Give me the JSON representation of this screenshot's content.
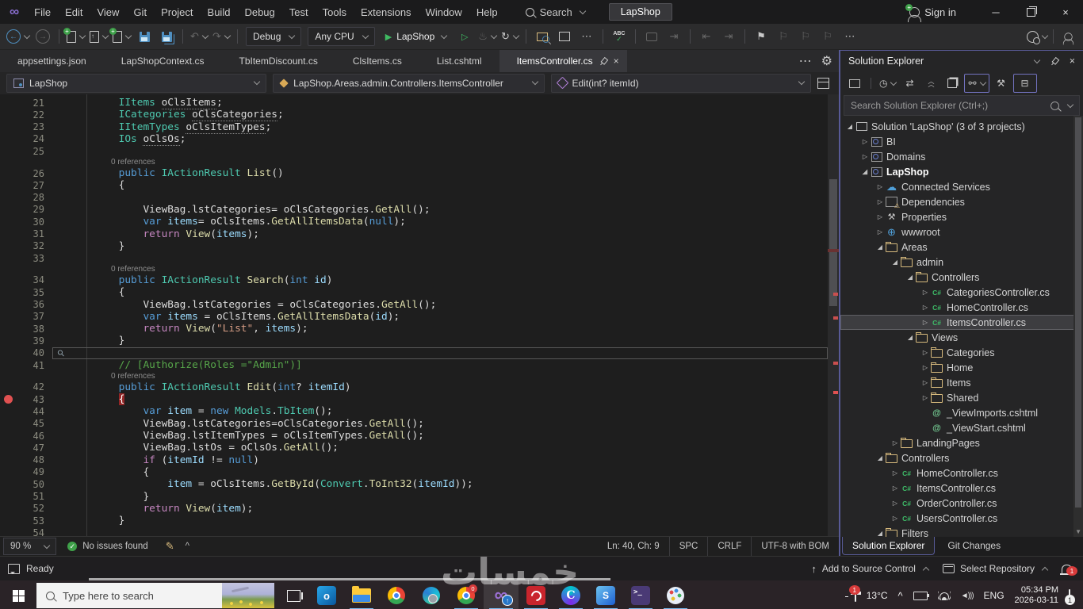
{
  "titlebar": {
    "menus": [
      "File",
      "Edit",
      "View",
      "Git",
      "Project",
      "Build",
      "Debug",
      "Test",
      "Tools",
      "Extensions",
      "Window",
      "Help"
    ],
    "search_label": "Search",
    "app_button": "LapShop",
    "sign_in": "Sign in"
  },
  "toolbar": {
    "config": "Debug",
    "platform": "Any CPU",
    "run_target": "LapShop"
  },
  "tabs": {
    "items": [
      {
        "label": "appsettings.json",
        "active": false
      },
      {
        "label": "LapShopContext.cs",
        "active": false
      },
      {
        "label": "TbItemDiscount.cs",
        "active": false
      },
      {
        "label": "ClsItems.cs",
        "active": false
      },
      {
        "label": "List.cshtml",
        "active": false
      },
      {
        "label": "ItemsController.cs",
        "active": true
      }
    ]
  },
  "breadcrumb": {
    "project": "LapShop",
    "type": "LapShop.Areas.admin.Controllers.ItemsController",
    "member": "Edit(int? itemId)"
  },
  "editor": {
    "colors": {
      "keyword": "#569cd6",
      "control": "#c586c0",
      "type": "#4ec9b0",
      "method": "#dcdcaa",
      "string": "#d69d85",
      "comment": "#57a64a",
      "local": "#9cdcfe",
      "breakpoint": "#e05151"
    },
    "rows": [
      {
        "n": "21",
        "s": [
          [
            "        ",
            "p"
          ],
          [
            "IItems",
            "t"
          ],
          [
            " ",
            "p"
          ],
          [
            "oClsItems",
            "u"
          ],
          [
            ";",
            "p"
          ]
        ]
      },
      {
        "n": "22",
        "s": [
          [
            "        ",
            "p"
          ],
          [
            "ICategories",
            "t"
          ],
          [
            " ",
            "p"
          ],
          [
            "oClsCategories",
            "u"
          ],
          [
            ";",
            "p"
          ]
        ]
      },
      {
        "n": "23",
        "s": [
          [
            "        ",
            "p"
          ],
          [
            "IItemTypes",
            "t"
          ],
          [
            " ",
            "p"
          ],
          [
            "oClsItemTypes",
            "u"
          ],
          [
            ";",
            "p"
          ]
        ]
      },
      {
        "n": "24",
        "s": [
          [
            "        ",
            "p"
          ],
          [
            "IOs",
            "t"
          ],
          [
            " ",
            "p"
          ],
          [
            "oClsOs",
            "u"
          ],
          [
            ";",
            "p"
          ]
        ]
      },
      {
        "n": "25",
        "s": []
      },
      {
        "lens": "0 references"
      },
      {
        "n": "26",
        "s": [
          [
            "        ",
            "p"
          ],
          [
            "public",
            "k"
          ],
          [
            " ",
            "p"
          ],
          [
            "IActionResult",
            "t"
          ],
          [
            " ",
            "p"
          ],
          [
            "List",
            "m"
          ],
          [
            "()",
            "p"
          ]
        ]
      },
      {
        "n": "27",
        "s": [
          [
            "        {",
            "p"
          ]
        ]
      },
      {
        "n": "28",
        "s": []
      },
      {
        "n": "29",
        "s": [
          [
            "            ViewBag.lstCategories= oClsCategories.",
            "p"
          ],
          [
            "GetAll",
            "m"
          ],
          [
            "();",
            "p"
          ]
        ]
      },
      {
        "n": "30",
        "s": [
          [
            "            ",
            "p"
          ],
          [
            "var",
            "k"
          ],
          [
            " ",
            "p"
          ],
          [
            "items",
            "v"
          ],
          [
            "= oClsItems.",
            "p"
          ],
          [
            "GetAllItemsData",
            "m"
          ],
          [
            "(",
            "p"
          ],
          [
            "null",
            "k"
          ],
          [
            ");",
            "p"
          ]
        ]
      },
      {
        "n": "31",
        "s": [
          [
            "            ",
            "p"
          ],
          [
            "return",
            "c"
          ],
          [
            " ",
            "p"
          ],
          [
            "View",
            "m"
          ],
          [
            "(",
            "p"
          ],
          [
            "items",
            "v"
          ],
          [
            ");",
            "p"
          ]
        ]
      },
      {
        "n": "32",
        "s": [
          [
            "        }",
            "p"
          ]
        ]
      },
      {
        "n": "33",
        "s": []
      },
      {
        "lens": "0 references"
      },
      {
        "n": "34",
        "s": [
          [
            "        ",
            "p"
          ],
          [
            "public",
            "k"
          ],
          [
            " ",
            "p"
          ],
          [
            "IActionResult",
            "t"
          ],
          [
            " ",
            "p"
          ],
          [
            "Search",
            "m"
          ],
          [
            "(",
            "p"
          ],
          [
            "int",
            "k"
          ],
          [
            " ",
            "p"
          ],
          [
            "id",
            "v"
          ],
          [
            ")",
            "p"
          ]
        ]
      },
      {
        "n": "35",
        "s": [
          [
            "        {",
            "p"
          ]
        ]
      },
      {
        "n": "36",
        "s": [
          [
            "            ViewBag.lstCategories = oClsCategories.",
            "p"
          ],
          [
            "GetAll",
            "m"
          ],
          [
            "();",
            "p"
          ]
        ]
      },
      {
        "n": "37",
        "s": [
          [
            "            ",
            "p"
          ],
          [
            "var",
            "k"
          ],
          [
            " ",
            "p"
          ],
          [
            "items",
            "v"
          ],
          [
            " = oClsItems.",
            "p"
          ],
          [
            "GetAllItemsData",
            "m"
          ],
          [
            "(",
            "p"
          ],
          [
            "id",
            "v"
          ],
          [
            ");",
            "p"
          ]
        ]
      },
      {
        "n": "38",
        "s": [
          [
            "            ",
            "p"
          ],
          [
            "return",
            "c"
          ],
          [
            " ",
            "p"
          ],
          [
            "View",
            "m"
          ],
          [
            "(",
            "p"
          ],
          [
            "\"List\"",
            "s"
          ],
          [
            ", ",
            "p"
          ],
          [
            "items",
            "v"
          ],
          [
            ");",
            "p"
          ]
        ]
      },
      {
        "n": "39",
        "s": [
          [
            "        }",
            "p"
          ]
        ]
      },
      {
        "n": "40",
        "s": [],
        "cur": true,
        "icon": "wrench"
      },
      {
        "n": "41",
        "s": [
          [
            "        ",
            "p"
          ],
          [
            "// [Authorize(Roles =\"Admin\")]",
            "cm"
          ]
        ]
      },
      {
        "lens": "0 references"
      },
      {
        "n": "42",
        "s": [
          [
            "        ",
            "p"
          ],
          [
            "public",
            "k"
          ],
          [
            " ",
            "p"
          ],
          [
            "IActionResult",
            "t"
          ],
          [
            " ",
            "p"
          ],
          [
            "Edit",
            "m"
          ],
          [
            "(",
            "p"
          ],
          [
            "int",
            "k"
          ],
          [
            "? ",
            "p"
          ],
          [
            "itemId",
            "v"
          ],
          [
            ")",
            "p"
          ]
        ]
      },
      {
        "n": "43",
        "s": [
          [
            "        ",
            "p"
          ],
          [
            "{",
            "bph"
          ]
        ],
        "bp": true
      },
      {
        "n": "44",
        "s": [
          [
            "            ",
            "p"
          ],
          [
            "var",
            "k"
          ],
          [
            " ",
            "p"
          ],
          [
            "item",
            "v"
          ],
          [
            " = ",
            "p"
          ],
          [
            "new",
            "k"
          ],
          [
            " ",
            "p"
          ],
          [
            "Models",
            "t"
          ],
          [
            ".",
            "p"
          ],
          [
            "TbItem",
            "t"
          ],
          [
            "();",
            "p"
          ]
        ]
      },
      {
        "n": "45",
        "s": [
          [
            "            ViewBag.lstCategories=oClsCategories.",
            "p"
          ],
          [
            "GetAll",
            "m"
          ],
          [
            "();",
            "p"
          ]
        ]
      },
      {
        "n": "46",
        "s": [
          [
            "            ViewBag.lstItemTypes = oClsItemTypes.",
            "p"
          ],
          [
            "GetAll",
            "m"
          ],
          [
            "();",
            "p"
          ]
        ]
      },
      {
        "n": "47",
        "s": [
          [
            "            ViewBag.lstOs = oClsOs.",
            "p"
          ],
          [
            "GetAll",
            "m"
          ],
          [
            "();",
            "p"
          ]
        ]
      },
      {
        "n": "48",
        "s": [
          [
            "            ",
            "p"
          ],
          [
            "if",
            "c"
          ],
          [
            " (",
            "p"
          ],
          [
            "itemId",
            "v"
          ],
          [
            " != ",
            "p"
          ],
          [
            "null",
            "k"
          ],
          [
            ")",
            "p"
          ]
        ]
      },
      {
        "n": "49",
        "s": [
          [
            "            {",
            "p"
          ]
        ]
      },
      {
        "n": "50",
        "s": [
          [
            "                ",
            "p"
          ],
          [
            "item",
            "v"
          ],
          [
            " = oClsItems.",
            "p"
          ],
          [
            "GetById",
            "m"
          ],
          [
            "(",
            "p"
          ],
          [
            "Convert",
            "t"
          ],
          [
            ".",
            "p"
          ],
          [
            "ToInt32",
            "m"
          ],
          [
            "(",
            "p"
          ],
          [
            "itemId",
            "v"
          ],
          [
            "));",
            "p"
          ]
        ]
      },
      {
        "n": "51",
        "s": [
          [
            "            }",
            "p"
          ]
        ]
      },
      {
        "n": "52",
        "s": [
          [
            "            ",
            "p"
          ],
          [
            "return",
            "c"
          ],
          [
            " ",
            "p"
          ],
          [
            "View",
            "m"
          ],
          [
            "(",
            "p"
          ],
          [
            "item",
            "v"
          ],
          [
            ");",
            "p"
          ]
        ]
      },
      {
        "n": "53",
        "s": [
          [
            "        }",
            "p"
          ]
        ]
      },
      {
        "n": "54",
        "s": []
      }
    ]
  },
  "editor_status": {
    "zoom": "90 %",
    "issues": "No issues found",
    "position": "Ln: 40, Ch: 9",
    "spaces": "SPC",
    "line_ending": "CRLF",
    "encoding": "UTF-8 with BOM"
  },
  "solution_explorer": {
    "title": "Solution Explorer",
    "search_placeholder": "Search Solution Explorer (Ctrl+;)",
    "tree": [
      {
        "label": "Solution 'LapShop' (3 of 3 projects)",
        "d": 0,
        "icon": "solution",
        "exp": "open"
      },
      {
        "label": "BI",
        "d": 1,
        "icon": "project",
        "exp": "closed"
      },
      {
        "label": "Domains",
        "d": 1,
        "icon": "project",
        "exp": "closed"
      },
      {
        "label": "LapShop",
        "d": 1,
        "icon": "project",
        "exp": "open",
        "bold": true
      },
      {
        "label": "Connected Services",
        "d": 2,
        "icon": "cloud",
        "exp": "closed"
      },
      {
        "label": "Dependencies",
        "d": 2,
        "icon": "deps",
        "exp": "closed"
      },
      {
        "label": "Properties",
        "d": 2,
        "icon": "props",
        "exp": "closed"
      },
      {
        "label": "wwwroot",
        "d": 2,
        "icon": "globe",
        "exp": "closed"
      },
      {
        "label": "Areas",
        "d": 2,
        "icon": "folder",
        "exp": "open"
      },
      {
        "label": "admin",
        "d": 3,
        "icon": "folder",
        "exp": "open"
      },
      {
        "label": "Controllers",
        "d": 4,
        "icon": "folder",
        "exp": "open"
      },
      {
        "label": "CategoriesController.cs",
        "d": 5,
        "icon": "cs",
        "exp": "closed"
      },
      {
        "label": "HomeController.cs",
        "d": 5,
        "icon": "cs",
        "exp": "closed"
      },
      {
        "label": "ItemsController.cs",
        "d": 5,
        "icon": "cs",
        "exp": "closed",
        "sel": true
      },
      {
        "label": "Views",
        "d": 4,
        "icon": "folder",
        "exp": "open"
      },
      {
        "label": "Categories",
        "d": 5,
        "icon": "folder",
        "exp": "closed"
      },
      {
        "label": "Home",
        "d": 5,
        "icon": "folder",
        "exp": "closed"
      },
      {
        "label": "Items",
        "d": 5,
        "icon": "folder",
        "exp": "closed"
      },
      {
        "label": "Shared",
        "d": 5,
        "icon": "folder",
        "exp": "closed"
      },
      {
        "label": "_ViewImports.cshtml",
        "d": 5,
        "icon": "razor"
      },
      {
        "label": "_ViewStart.cshtml",
        "d": 5,
        "icon": "razor"
      },
      {
        "label": "LandingPages",
        "d": 3,
        "icon": "folder",
        "exp": "closed"
      },
      {
        "label": "Controllers",
        "d": 2,
        "icon": "folder",
        "exp": "open"
      },
      {
        "label": "HomeController.cs",
        "d": 3,
        "icon": "cs",
        "exp": "closed"
      },
      {
        "label": "ItemsController.cs",
        "d": 3,
        "icon": "cs",
        "exp": "closed"
      },
      {
        "label": "OrderController.cs",
        "d": 3,
        "icon": "cs",
        "exp": "closed"
      },
      {
        "label": "UsersController.cs",
        "d": 3,
        "icon": "cs",
        "exp": "closed"
      },
      {
        "label": "Filters",
        "d": 2,
        "icon": "folder",
        "exp": "open"
      }
    ],
    "tabs": [
      {
        "label": "Solution Explorer",
        "active": true
      },
      {
        "label": "Git Changes",
        "active": false
      }
    ]
  },
  "status_bar": {
    "ready": "Ready",
    "source_control": "Add to Source Control",
    "repository": "Select Repository",
    "bell_badge": "1"
  },
  "taskbar": {
    "search_placeholder": "Type here to search",
    "apps": [
      {
        "name": "outlook",
        "glyph": "o",
        "active": false
      },
      {
        "name": "file-explorer",
        "glyph": "",
        "active": true
      },
      {
        "name": "chrome",
        "glyph": "",
        "active": false
      },
      {
        "name": "edge",
        "glyph": "",
        "active": false
      },
      {
        "name": "chrome-profile",
        "glyph": "",
        "active": true,
        "badge": "0"
      },
      {
        "name": "visual-studio",
        "glyph": "∞",
        "active": true,
        "focused": true,
        "up_badge": "↑"
      },
      {
        "name": "acrobat",
        "glyph": "",
        "active": true
      },
      {
        "name": "canva",
        "glyph": "C",
        "active": true
      },
      {
        "name": "ssms",
        "glyph": "S",
        "active": true
      },
      {
        "name": "terminal",
        "glyph": ">_",
        "active": true
      },
      {
        "name": "paint",
        "glyph": "",
        "active": true
      }
    ],
    "tray": {
      "news_badge": "1",
      "temperature": "13°C",
      "language": "ENG",
      "time": "05:34 PM",
      "date": "2026-03-11",
      "action_badge": "1"
    }
  },
  "watermark": "خمسات"
}
